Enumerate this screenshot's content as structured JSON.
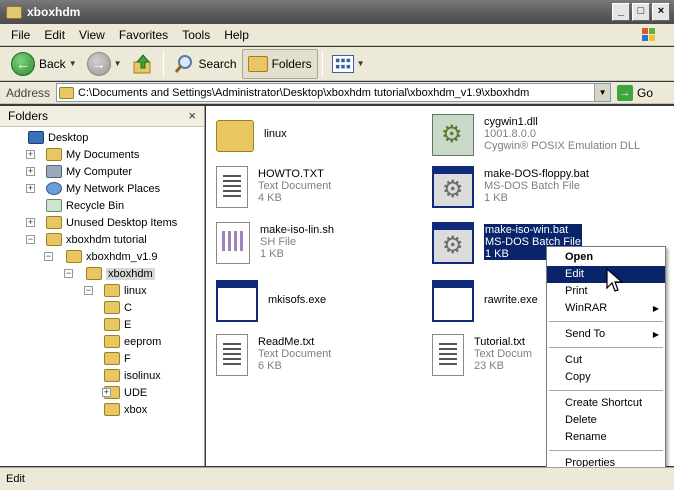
{
  "window": {
    "title": "xboxhdm"
  },
  "window_buttons": {
    "minimize": "_",
    "maximize": "□",
    "close": "×"
  },
  "menu": [
    "File",
    "Edit",
    "View",
    "Favorites",
    "Tools",
    "Help"
  ],
  "toolbar": {
    "back": "Back",
    "search": "Search",
    "folders": "Folders"
  },
  "address": {
    "label": "Address",
    "value": "C:\\Documents and Settings\\Administrator\\Desktop\\xboxhdm tutorial\\xboxhdm_v1.9\\xboxhdm",
    "go": "Go"
  },
  "folders_pane": {
    "title": "Folders",
    "close": "×",
    "tree": [
      {
        "label": "Desktop",
        "icon": "desktop-icon",
        "level": 0,
        "expander": ""
      },
      {
        "label": "My Documents",
        "icon": "documents-icon",
        "level": 1,
        "expander": "+"
      },
      {
        "label": "My Computer",
        "icon": "computer-icon",
        "level": 1,
        "expander": "+"
      },
      {
        "label": "My Network Places",
        "icon": "network-icon",
        "level": 1,
        "expander": "+"
      },
      {
        "label": "Recycle Bin",
        "icon": "recycle-bin-icon",
        "level": 1,
        "expander": ""
      },
      {
        "label": "Unused Desktop Items",
        "icon": "folder-icon",
        "level": 1,
        "expander": "+"
      },
      {
        "label": "xboxhdm tutorial",
        "icon": "folder-icon",
        "level": 1,
        "expander": "−"
      },
      {
        "label": "xboxhdm_v1.9",
        "icon": "folder-icon",
        "level": 2,
        "expander": "−"
      },
      {
        "label": "xboxhdm",
        "icon": "folder-icon",
        "level": 3,
        "expander": "−",
        "selected": true
      },
      {
        "label": "linux",
        "icon": "folder-icon",
        "level": 4,
        "expander": "−"
      },
      {
        "label": "C",
        "icon": "folder-icon",
        "level": 5,
        "expander": ""
      },
      {
        "label": "E",
        "icon": "folder-icon",
        "level": 5,
        "expander": ""
      },
      {
        "label": "eeprom",
        "icon": "folder-icon",
        "level": 5,
        "expander": ""
      },
      {
        "label": "F",
        "icon": "folder-icon",
        "level": 5,
        "expander": ""
      },
      {
        "label": "isolinux",
        "icon": "folder-icon",
        "level": 5,
        "expander": ""
      },
      {
        "label": "UDE",
        "icon": "folder-icon",
        "level": 5,
        "expander": "+"
      },
      {
        "label": "xbox",
        "icon": "folder-icon",
        "level": 5,
        "expander": ""
      }
    ]
  },
  "files": [
    {
      "name": "linux",
      "type": "",
      "size": "",
      "icon": "folder-icon"
    },
    {
      "name": "cygwin1.dll",
      "type": "1001.8.0.0",
      "size": "Cygwin® POSIX Emulation DLL",
      "icon": "dll-icon"
    },
    {
      "name": "HOWTO.TXT",
      "type": "Text Document",
      "size": "4 KB",
      "icon": "text-document-icon"
    },
    {
      "name": "make-DOS-floppy.bat",
      "type": "MS-DOS Batch File",
      "size": "1 KB",
      "icon": "batch-file-icon"
    },
    {
      "name": "make-iso-lin.sh",
      "type": "SH File",
      "size": "1 KB",
      "icon": "sh-file-icon"
    },
    {
      "name": "make-iso-win.bat",
      "type": "MS-DOS Batch File",
      "size": "1 KB",
      "icon": "batch-file-icon",
      "selected": true
    },
    {
      "name": "mkisofs.exe",
      "type": "",
      "size": "",
      "icon": "exe-icon"
    },
    {
      "name": "rawrite.exe",
      "type": "",
      "size": "",
      "icon": "exe-icon"
    },
    {
      "name": "ReadMe.txt",
      "type": "Text Document",
      "size": "6 KB",
      "icon": "text-document-icon"
    },
    {
      "name": "Tutorial.txt",
      "type": "Text Docum",
      "size": "23 KB",
      "icon": "text-document-icon"
    }
  ],
  "context_menu": {
    "groups": [
      [
        {
          "label": "Open",
          "bold": true
        },
        {
          "label": "Edit",
          "highlighted": true
        },
        {
          "label": "Print"
        },
        {
          "label": "WinRAR",
          "submenu": true
        }
      ],
      [
        {
          "label": "Send To",
          "submenu": true
        }
      ],
      [
        {
          "label": "Cut"
        },
        {
          "label": "Copy"
        }
      ],
      [
        {
          "label": "Create Shortcut"
        },
        {
          "label": "Delete"
        },
        {
          "label": "Rename"
        }
      ],
      [
        {
          "label": "Properties"
        }
      ]
    ]
  },
  "status": {
    "text": "Edit"
  },
  "colors": {
    "selection": "#0a246a",
    "chrome": "#ece9d8",
    "folder": "#e8c763"
  }
}
